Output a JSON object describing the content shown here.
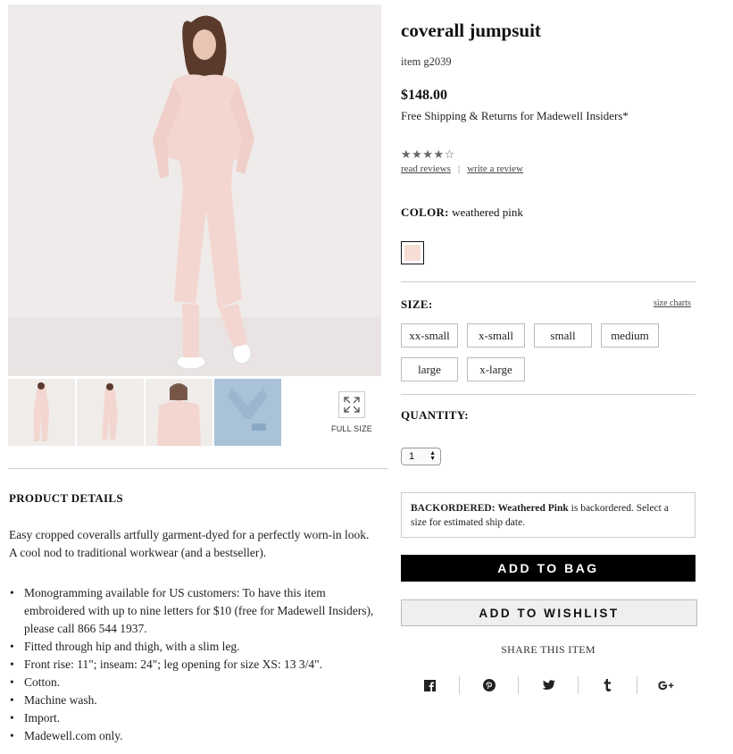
{
  "product": {
    "title": "coverall jumpsuit",
    "item_number": "item g2039",
    "price": "$148.00",
    "shipping_note": "Free Shipping & Returns for Madewell Insiders*",
    "rating": 4.5,
    "stars_display": "★★★★☆",
    "read_reviews": "read reviews",
    "review_separator": "|",
    "write_review": "write a review"
  },
  "color": {
    "label": "COLOR:",
    "value": "weathered pink",
    "swatch_hex": "#f6ddd6"
  },
  "size": {
    "label": "SIZE:",
    "charts_link": "size charts",
    "options": [
      "xx-small",
      "x-small",
      "small",
      "medium",
      "large",
      "x-large"
    ]
  },
  "quantity": {
    "label": "QUANTITY:",
    "value": "1"
  },
  "backorder": {
    "status": "BACKORDERED:",
    "color_name": "Weathered Pink",
    "message": "is backordered. Select a size for estimated ship date."
  },
  "actions": {
    "add_to_bag": "ADD TO BAG",
    "add_to_wishlist": "ADD TO WISHLIST"
  },
  "share": {
    "label": "SHARE THIS ITEM",
    "icons": [
      "facebook-icon",
      "pinterest-icon",
      "twitter-icon",
      "tumblr-icon",
      "google-plus-icon"
    ]
  },
  "gallery": {
    "full_size_label": "FULL SIZE"
  },
  "details": {
    "heading": "PRODUCT DETAILS",
    "description": "Easy cropped coveralls artfully garment-dyed for a perfectly worn-in look. A cool nod to traditional workwear (and a bestseller).",
    "bullets": [
      "Monogramming available for US customers: To have this item embroidered with up to nine letters for $10 (free for Madewell Insiders), please call 866 544 1937.",
      "Fitted through hip and thigh, with a slim leg.",
      "Front rise: 11\"; inseam: 24\"; leg opening for size XS: 13 3/4\".",
      "Cotton.",
      "Machine wash.",
      "Import.",
      "Madewell.com only."
    ]
  },
  "colors": {
    "accent_black": "#000000",
    "product_pink": "#f3d6cf"
  }
}
